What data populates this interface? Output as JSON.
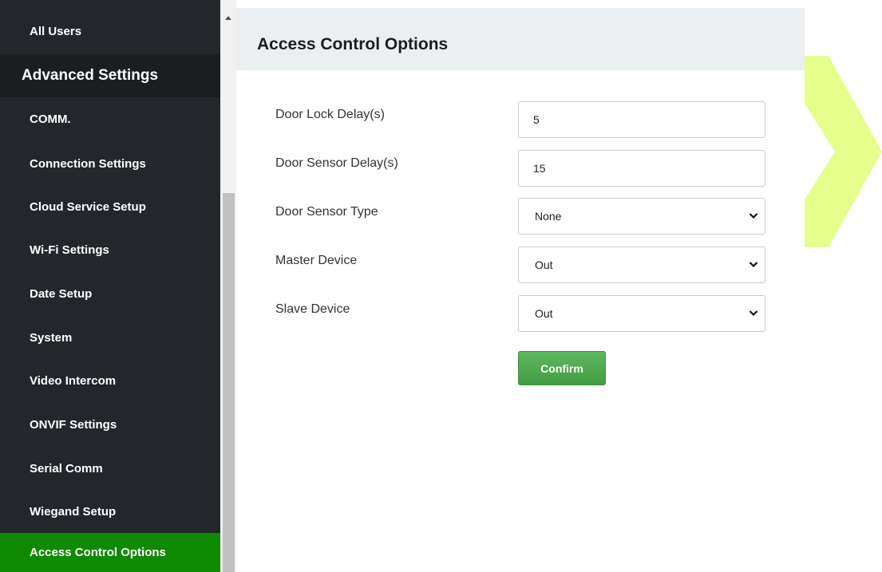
{
  "sidebar": {
    "top_item": "All Users",
    "section_header": "Advanced Settings",
    "items": [
      {
        "label": "COMM."
      },
      {
        "label": "Connection Settings"
      },
      {
        "label": "Cloud Service Setup"
      },
      {
        "label": "Wi-Fi Settings"
      },
      {
        "label": "Date Setup"
      },
      {
        "label": "System"
      },
      {
        "label": "Video Intercom"
      },
      {
        "label": "ONVIF Settings"
      },
      {
        "label": "Serial Comm"
      },
      {
        "label": "Wiegand Setup"
      },
      {
        "label": "Access Control Options",
        "active": true
      }
    ]
  },
  "page": {
    "title": "Access Control Options"
  },
  "form": {
    "door_lock_delay": {
      "label": "Door Lock Delay(s)",
      "value": "5"
    },
    "door_sensor_delay": {
      "label": "Door Sensor Delay(s)",
      "value": "15"
    },
    "door_sensor_type": {
      "label": "Door Sensor Type",
      "value": "None"
    },
    "master_device": {
      "label": "Master Device",
      "value": "Out"
    },
    "slave_device": {
      "label": "Slave Device",
      "value": "Out"
    },
    "confirm_label": "Confirm"
  },
  "colors": {
    "sidebar_bg": "#23272b",
    "active_item": "#0f8a00",
    "confirm_button": "#5cb85c",
    "watermark": "#d8ff4f"
  },
  "icons": {
    "select_arrow": "chevron-down-icon",
    "scroll_up": "scroll-up-arrow-icon"
  }
}
